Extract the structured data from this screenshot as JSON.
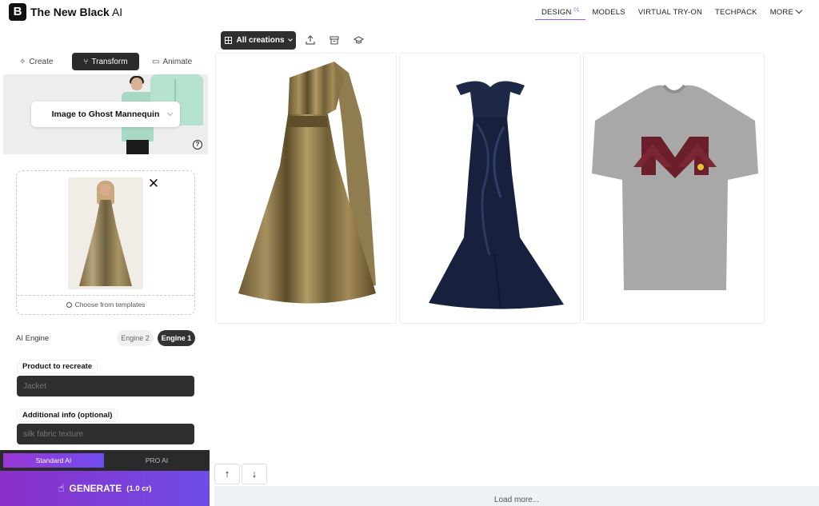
{
  "brand": {
    "logo_letter": "B",
    "name": "The New Black",
    "suffix": " AI"
  },
  "nav": [
    {
      "label": "DESIGN",
      "badge": "01"
    },
    {
      "label": "MODELS"
    },
    {
      "label": "VIRTUAL TRY-ON"
    },
    {
      "label": "TECHPACK"
    },
    {
      "label": "MORE"
    }
  ],
  "mode_tabs": {
    "create": "Create",
    "transform": "Transform",
    "animate": "Animate"
  },
  "preset": {
    "label": "Image to Ghost Mannequin",
    "help": "?"
  },
  "upload": {
    "close": "✕",
    "templates_link": "Choose from templates"
  },
  "engine": {
    "label": "AI Engine",
    "option_2": "Engine 2",
    "option_1": "Engine 1",
    "selected": "Engine 1"
  },
  "fields": {
    "product_label": "Product to recreate",
    "product_placeholder": "Jacket",
    "additional_label": "Additional info (optional)",
    "additional_placeholder": "silk fabric texture"
  },
  "tiers": {
    "standard": "Standard AI",
    "pro": "PRO AI",
    "selected": "Standard AI"
  },
  "generate": {
    "label": "GENERATE",
    "cost": "(1.0 cr)"
  },
  "toolbar": {
    "filter_label": "All creations"
  },
  "gallery": [
    "gold-pleated-one-shoulder-gown",
    "navy-off-shoulder-satin-gown",
    "grey-tshirt-maroon-m-print"
  ],
  "scroll": {
    "up": "↑",
    "down": "↓"
  },
  "load_more": "Load more...",
  "colors": {
    "accent": "#8b5cf6",
    "generate_start": "#8b2fc9",
    "generate_end": "#6e4de6",
    "dark": "#2f2f2f"
  }
}
